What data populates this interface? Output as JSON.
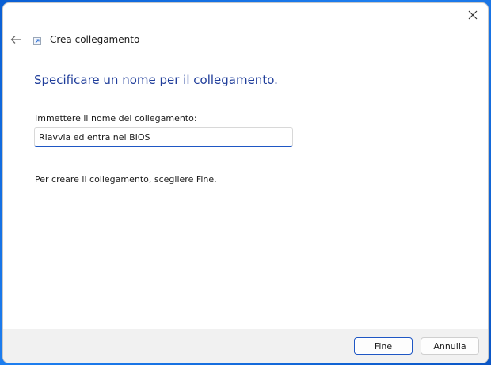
{
  "window": {
    "title": "Crea collegamento",
    "close_icon": "close-icon",
    "back_icon": "back-arrow-icon",
    "app_icon": "shortcut-icon"
  },
  "main": {
    "heading": "Specificare un nome per il collegamento.",
    "field_label": "Immettere il nome del collegamento:",
    "field_value": "Riavvia ed entra nel BIOS",
    "instruction": "Per creare il collegamento, scegliere Fine."
  },
  "footer": {
    "finish_label": "Fine",
    "cancel_label": "Annulla"
  },
  "colors": {
    "accent": "#1f57c4",
    "heading": "#1f3d9a",
    "footer_bg": "#f1f1f1"
  }
}
